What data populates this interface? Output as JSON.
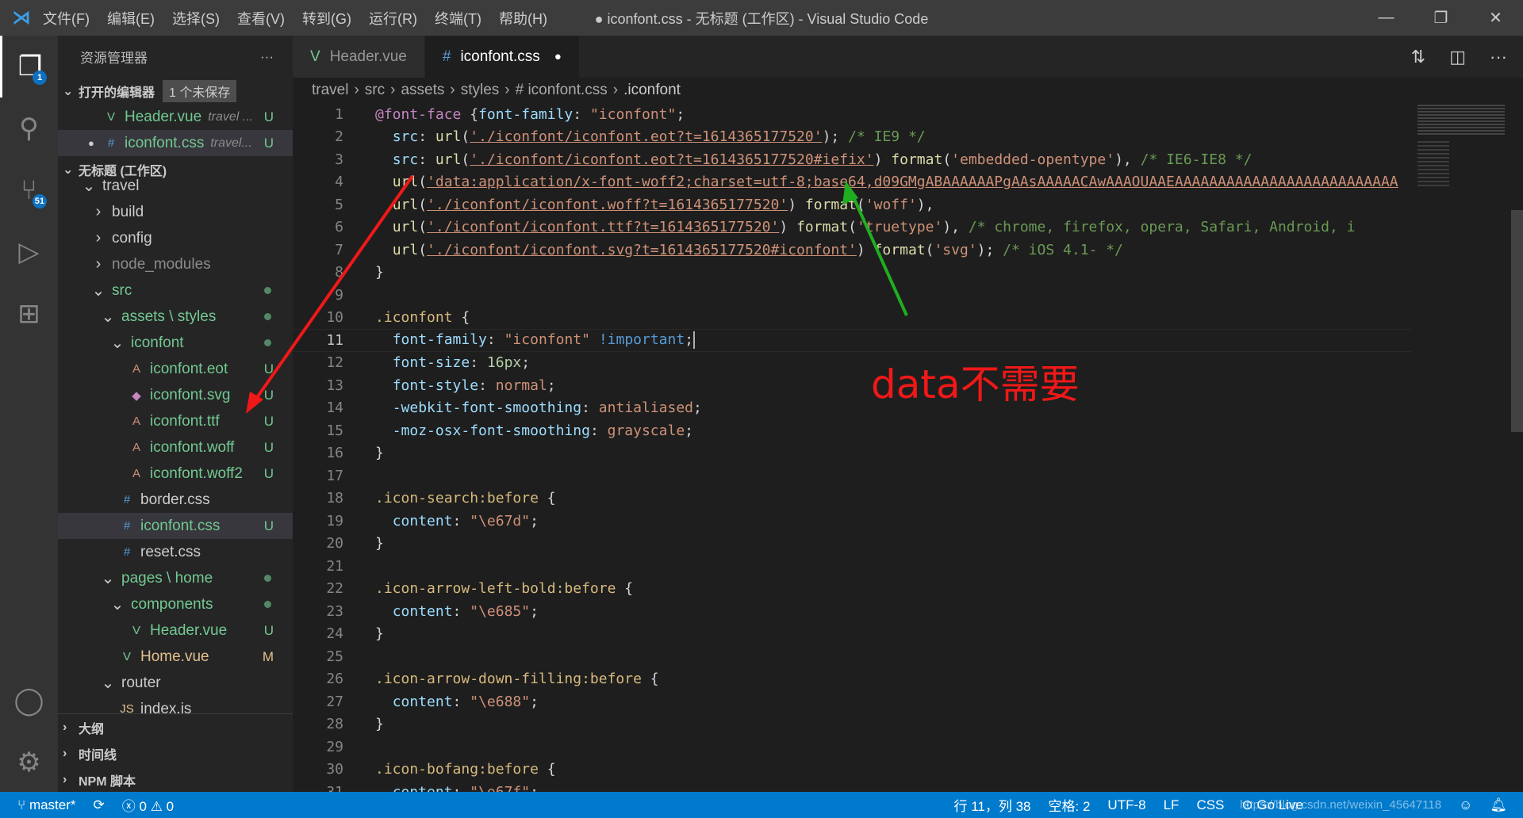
{
  "titlebar": {
    "menu": [
      "文件(F)",
      "编辑(E)",
      "选择(S)",
      "查看(V)",
      "转到(G)",
      "运行(R)",
      "终端(T)",
      "帮助(H)"
    ],
    "title": "● iconfont.css - 无标题 (工作区) - Visual Studio Code"
  },
  "activity": {
    "explorer_badge": "1",
    "scm_badge": "51"
  },
  "sidebar": {
    "title": "资源管理器",
    "open_editors": "打开的编辑器",
    "unsaved": "1 个未保存",
    "open_files": [
      {
        "name": "Header.vue",
        "path": "travel ...",
        "status": "U"
      },
      {
        "name": "iconfont.css",
        "path": "travel...",
        "status": "U"
      }
    ],
    "workspace": "无标题 (工作区)",
    "tree": [
      {
        "name": "travel",
        "depth": 0,
        "type": "folder-open",
        "status": ""
      },
      {
        "name": "build",
        "depth": 1,
        "type": "folder",
        "status": ""
      },
      {
        "name": "config",
        "depth": 1,
        "type": "folder",
        "status": ""
      },
      {
        "name": "node_modules",
        "depth": 1,
        "type": "folder",
        "status": "",
        "muted": true
      },
      {
        "name": "src",
        "depth": 1,
        "type": "folder-open",
        "status": "dot"
      },
      {
        "name": "assets \\ styles",
        "depth": 2,
        "type": "folder-open",
        "status": "dot"
      },
      {
        "name": "iconfont",
        "depth": 3,
        "type": "folder-open",
        "status": "dot"
      },
      {
        "name": "iconfont.eot",
        "depth": 4,
        "type": "font",
        "status": "U"
      },
      {
        "name": "iconfont.svg",
        "depth": 4,
        "type": "svg",
        "status": "U"
      },
      {
        "name": "iconfont.ttf",
        "depth": 4,
        "type": "font",
        "status": "U"
      },
      {
        "name": "iconfont.woff",
        "depth": 4,
        "type": "font",
        "status": "U"
      },
      {
        "name": "iconfont.woff2",
        "depth": 4,
        "type": "font",
        "status": "U"
      },
      {
        "name": "border.css",
        "depth": 3,
        "type": "css",
        "status": ""
      },
      {
        "name": "iconfont.css",
        "depth": 3,
        "type": "css",
        "status": "U",
        "selected": true
      },
      {
        "name": "reset.css",
        "depth": 3,
        "type": "css",
        "status": ""
      },
      {
        "name": "pages \\ home",
        "depth": 2,
        "type": "folder-open",
        "status": "dot"
      },
      {
        "name": "components",
        "depth": 3,
        "type": "folder-open",
        "status": "dot"
      },
      {
        "name": "Header.vue",
        "depth": 4,
        "type": "vue",
        "status": "U"
      },
      {
        "name": "Home.vue",
        "depth": 3,
        "type": "vue",
        "status": "M"
      },
      {
        "name": "router",
        "depth": 2,
        "type": "folder-open",
        "status": ""
      },
      {
        "name": "index.js",
        "depth": 3,
        "type": "js",
        "status": ""
      }
    ],
    "bottom_sections": [
      "大纲",
      "时间线",
      "NPM 脚本"
    ]
  },
  "tabs": [
    {
      "label": "Header.vue",
      "active": false
    },
    {
      "label": "iconfont.css",
      "active": true,
      "dirty": true
    }
  ],
  "breadcrumb": [
    "travel",
    "src",
    "assets",
    "styles",
    "# iconfont.css",
    ".iconfont"
  ],
  "editor": {
    "current_line": 11,
    "lines": [
      [
        [
          "k",
          "@font-face"
        ],
        [
          "w",
          " {"
        ],
        [
          "p",
          "font-family"
        ],
        [
          "w",
          ": "
        ],
        [
          "s",
          "\"iconfont\""
        ],
        [
          "w",
          ";"
        ]
      ],
      [
        [
          "w",
          "  "
        ],
        [
          "p",
          "src"
        ],
        [
          "w",
          ": "
        ],
        [
          "f",
          "url"
        ],
        [
          "w",
          "("
        ],
        [
          "su",
          "'./iconfont/iconfont.eot?t=1614365177520'"
        ],
        [
          "w",
          ");"
        ],
        [
          "c",
          " /* IE9 */"
        ]
      ],
      [
        [
          "w",
          "  "
        ],
        [
          "p",
          "src"
        ],
        [
          "w",
          ": "
        ],
        [
          "f",
          "url"
        ],
        [
          "w",
          "("
        ],
        [
          "su",
          "'./iconfont/iconfont.eot?t=1614365177520#iefix'"
        ],
        [
          "w",
          ") "
        ],
        [
          "f",
          "format"
        ],
        [
          "w",
          "("
        ],
        [
          "s",
          "'embedded-opentype'"
        ],
        [
          "w",
          "), "
        ],
        [
          "c",
          "/* IE6-IE8 */"
        ]
      ],
      [
        [
          "w",
          "  "
        ],
        [
          "f",
          "url"
        ],
        [
          "w",
          "("
        ],
        [
          "su",
          "'data:application/x-font-woff2;charset=utf-8;base64,d09GMgABAAAAAAPgAAsAAAAACAwAAAOUAAEAAAAAAAAAAAAAAAAAAAAAAAAAA"
        ]
      ],
      [
        [
          "w",
          "  "
        ],
        [
          "f",
          "url"
        ],
        [
          "w",
          "("
        ],
        [
          "su",
          "'./iconfont/iconfont.woff?t=1614365177520'"
        ],
        [
          "w",
          ") "
        ],
        [
          "f",
          "format"
        ],
        [
          "w",
          "("
        ],
        [
          "s",
          "'woff'"
        ],
        [
          "w",
          "),"
        ]
      ],
      [
        [
          "w",
          "  "
        ],
        [
          "f",
          "url"
        ],
        [
          "w",
          "("
        ],
        [
          "su",
          "'./iconfont/iconfont.ttf?t=1614365177520'"
        ],
        [
          "w",
          ") "
        ],
        [
          "f",
          "format"
        ],
        [
          "w",
          "("
        ],
        [
          "s",
          "'truetype'"
        ],
        [
          "w",
          "), "
        ],
        [
          "c",
          "/* chrome, firefox, opera, Safari, Android, i"
        ]
      ],
      [
        [
          "w",
          "  "
        ],
        [
          "f",
          "url"
        ],
        [
          "w",
          "("
        ],
        [
          "su",
          "'./iconfont/iconfont.svg?t=1614365177520#iconfont'"
        ],
        [
          "w",
          ") "
        ],
        [
          "f",
          "format"
        ],
        [
          "w",
          "("
        ],
        [
          "s",
          "'svg'"
        ],
        [
          "w",
          "); "
        ],
        [
          "c",
          "/* iOS 4.1- */"
        ]
      ],
      [
        [
          "w",
          "}"
        ]
      ],
      [],
      [
        [
          "sel-c",
          ".iconfont"
        ],
        [
          "w",
          " {"
        ]
      ],
      [
        [
          "w",
          "  "
        ],
        [
          "p",
          "font-family"
        ],
        [
          "w",
          ": "
        ],
        [
          "s",
          "\"iconfont\""
        ],
        [
          "w",
          " "
        ],
        [
          "kw",
          "!important"
        ],
        [
          "w",
          ";"
        ]
      ],
      [
        [
          "w",
          "  "
        ],
        [
          "p",
          "font-size"
        ],
        [
          "w",
          ": "
        ],
        [
          "n",
          "16px"
        ],
        [
          "w",
          ";"
        ]
      ],
      [
        [
          "w",
          "  "
        ],
        [
          "p",
          "font-style"
        ],
        [
          "w",
          ": "
        ],
        [
          "s",
          "normal"
        ],
        [
          "w",
          ";"
        ]
      ],
      [
        [
          "w",
          "  "
        ],
        [
          "p",
          "-webkit-font-smoothing"
        ],
        [
          "w",
          ": "
        ],
        [
          "s",
          "antialiased"
        ],
        [
          "w",
          ";"
        ]
      ],
      [
        [
          "w",
          "  "
        ],
        [
          "p",
          "-moz-osx-font-smoothing"
        ],
        [
          "w",
          ": "
        ],
        [
          "s",
          "grayscale"
        ],
        [
          "w",
          ";"
        ]
      ],
      [
        [
          "w",
          "}"
        ]
      ],
      [],
      [
        [
          "sel-c",
          ".icon-search:before"
        ],
        [
          "w",
          " {"
        ]
      ],
      [
        [
          "w",
          "  "
        ],
        [
          "p",
          "content"
        ],
        [
          "w",
          ": "
        ],
        [
          "s",
          "\"\\e67d\""
        ],
        [
          "w",
          ";"
        ]
      ],
      [
        [
          "w",
          "}"
        ]
      ],
      [],
      [
        [
          "sel-c",
          ".icon-arrow-left-bold:before"
        ],
        [
          "w",
          " {"
        ]
      ],
      [
        [
          "w",
          "  "
        ],
        [
          "p",
          "content"
        ],
        [
          "w",
          ": "
        ],
        [
          "s",
          "\"\\e685\""
        ],
        [
          "w",
          ";"
        ]
      ],
      [
        [
          "w",
          "}"
        ]
      ],
      [],
      [
        [
          "sel-c",
          ".icon-arrow-down-filling:before"
        ],
        [
          "w",
          " {"
        ]
      ],
      [
        [
          "w",
          "  "
        ],
        [
          "p",
          "content"
        ],
        [
          "w",
          ": "
        ],
        [
          "s",
          "\"\\e688\""
        ],
        [
          "w",
          ";"
        ]
      ],
      [
        [
          "w",
          "}"
        ]
      ],
      [],
      [
        [
          "sel-c",
          ".icon-bofang:before"
        ],
        [
          "w",
          " {"
        ]
      ],
      [
        [
          "w",
          "  "
        ],
        [
          "p",
          "content"
        ],
        [
          "w",
          ": "
        ],
        [
          "s",
          "\"\\e67f\""
        ],
        [
          "w",
          ";"
        ]
      ]
    ]
  },
  "annotation": "data不需要",
  "status": {
    "branch": "master*",
    "errors": "0",
    "warnings": "0",
    "position": "行 11，列 38",
    "spaces": "空格: 2",
    "encoding": "UTF-8",
    "eol": "LF",
    "language": "CSS",
    "golive": "Go Live",
    "watermark": "https://blog.csdn.net/weixin_45647118"
  },
  "colors": {
    "statusbar": "#007acc",
    "annotation_red": "#f01818",
    "arrow_green": "#1fae1f"
  }
}
